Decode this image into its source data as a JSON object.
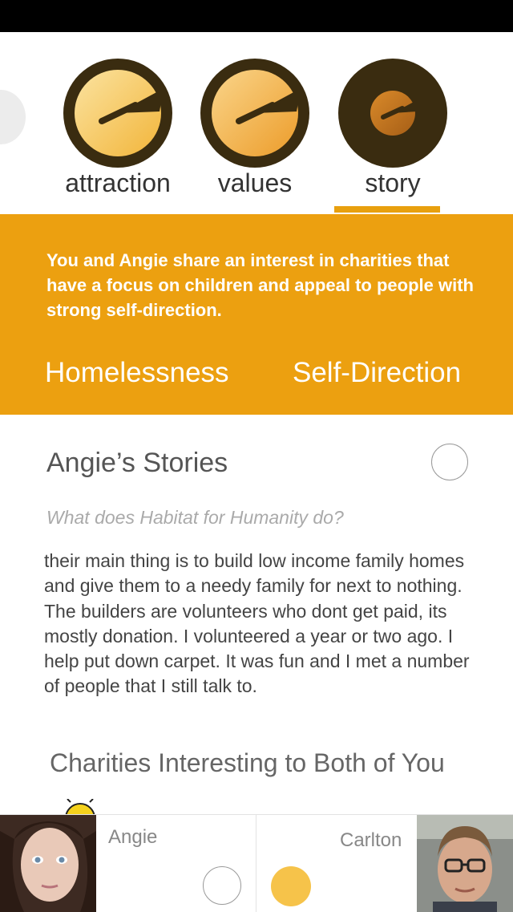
{
  "tabs": [
    {
      "label": "attraction",
      "selected": false,
      "fill_level": 1.0
    },
    {
      "label": "values",
      "selected": false,
      "fill_level": 1.0
    },
    {
      "label": "story",
      "selected": true,
      "fill_level": 0.55
    }
  ],
  "banner": {
    "summary": "You and Angie share an interest in charities that have a focus on children and appeal to people with strong self-direction.",
    "tags": [
      "Homelessness",
      "Self-Direction"
    ]
  },
  "stories": {
    "title": "Angie’s Stories",
    "question": "What does Habitat for Humanity do?",
    "answer": "their main thing is to build low income family homes and give them to a needy family for next to nothing. The builders are volunteers who dont get paid, its mostly donation. I volunteered a year or two ago. I help put down carpet. It was fun and I met a number of people that I still talk to."
  },
  "charities": {
    "title": "Charities Interesting to Both of You"
  },
  "footer": {
    "left_user": {
      "name": "Angie",
      "selected": false
    },
    "right_user": {
      "name": "Carlton",
      "selected": true
    }
  },
  "colors": {
    "accent": "#eca010",
    "dark_ring": "#3a2c10",
    "selected_dot": "#f6c34a",
    "status_bar": "#000000"
  }
}
